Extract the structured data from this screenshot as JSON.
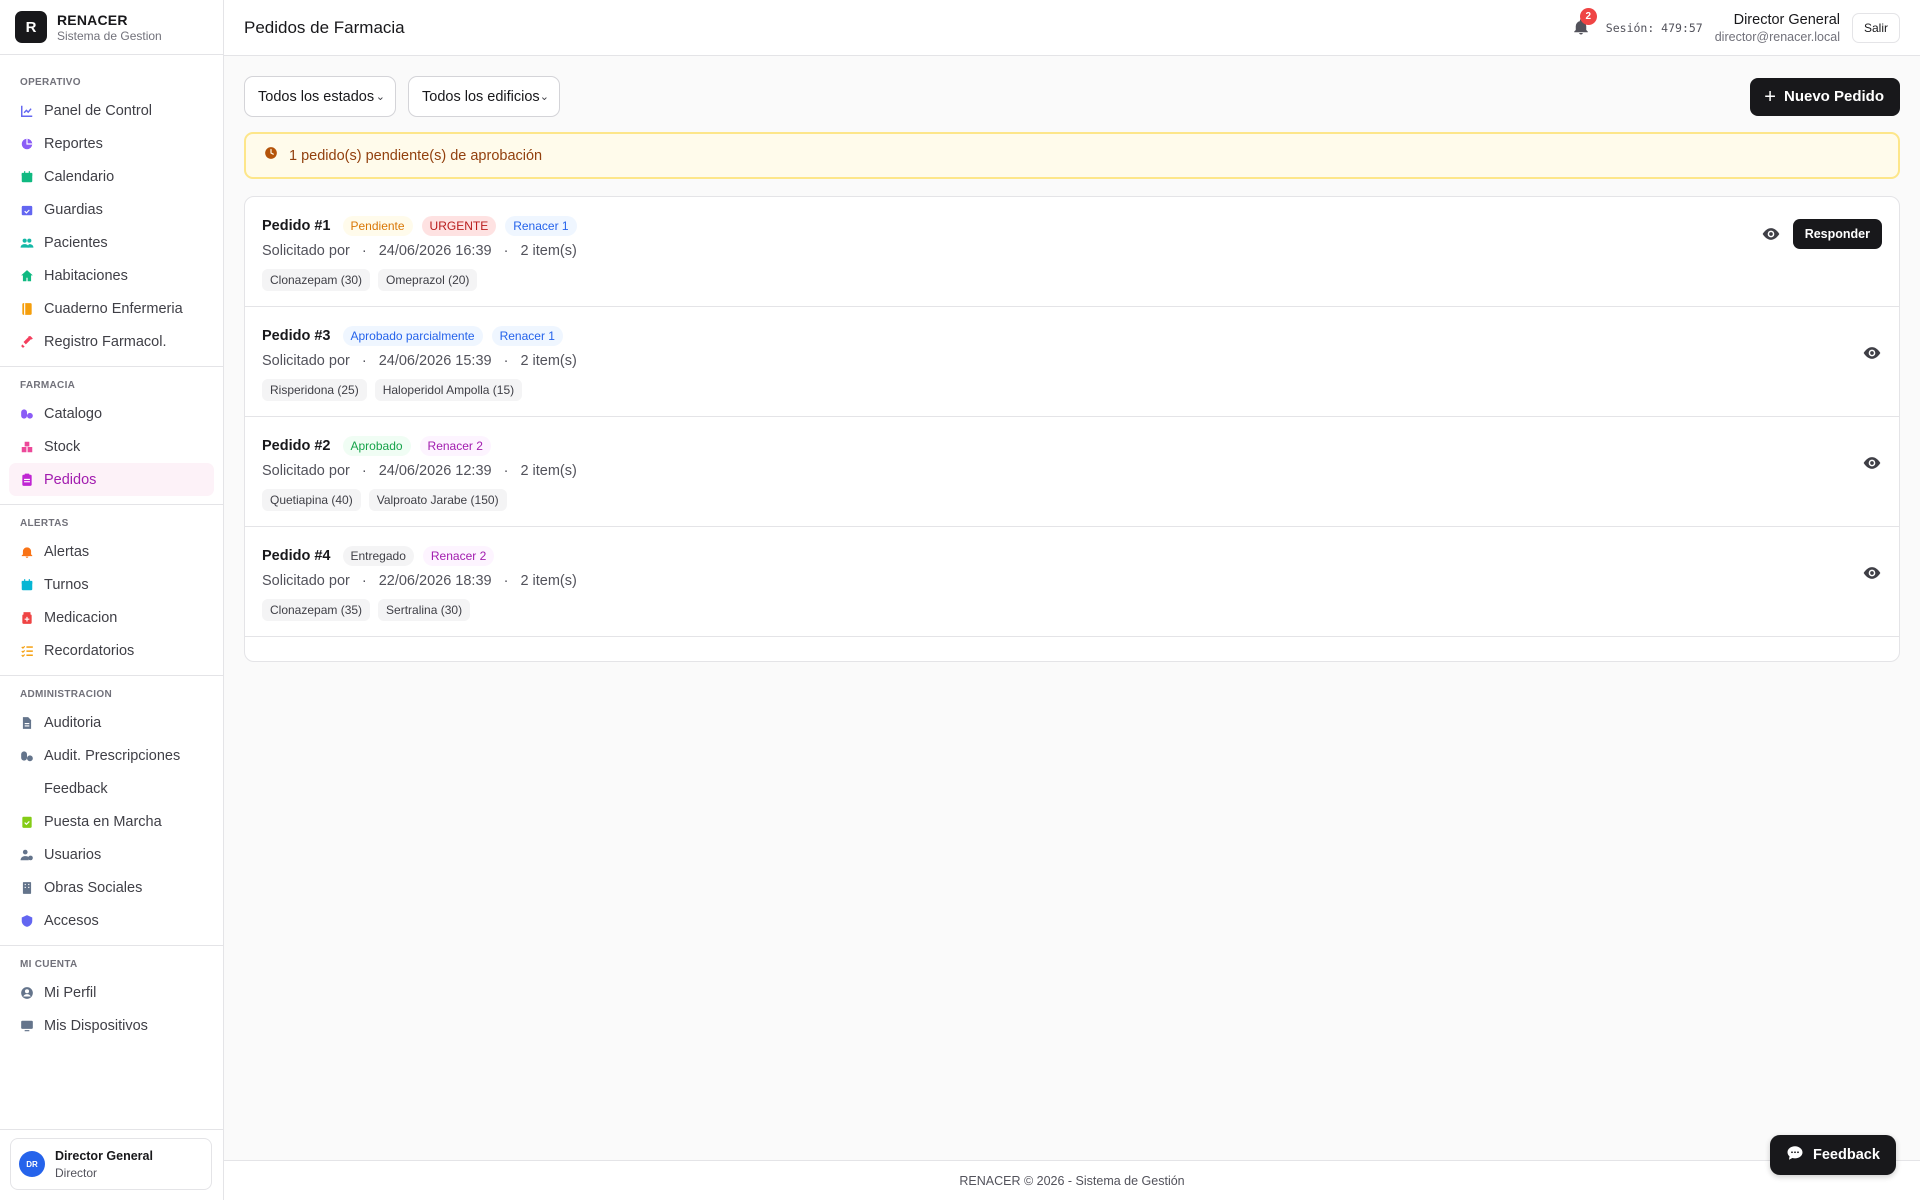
{
  "brand": {
    "logo_letter": "R",
    "title": "RENACER",
    "subtitle": "Sistema de Gestion"
  },
  "sidebar": {
    "sections": [
      {
        "title": "OPERATIVO",
        "items": [
          {
            "label": "Panel de Control",
            "icon": "chart-line-icon",
            "color": "#6366f1"
          },
          {
            "label": "Reportes",
            "icon": "pie-chart-icon",
            "color": "#8b5cf6"
          },
          {
            "label": "Calendario",
            "icon": "calendar-icon",
            "color": "#10b981"
          },
          {
            "label": "Guardias",
            "icon": "calendar-check-icon",
            "color": "#6366f1"
          },
          {
            "label": "Pacientes",
            "icon": "users-icon",
            "color": "#14b8a6"
          },
          {
            "label": "Habitaciones",
            "icon": "house-icon",
            "color": "#10b981"
          },
          {
            "label": "Cuaderno Enfermeria",
            "icon": "notebook-icon",
            "color": "#f59e0b"
          },
          {
            "label": "Registro Farmacol.",
            "icon": "syringe-icon",
            "color": "#f43f5e"
          }
        ]
      },
      {
        "title": "FARMACIA",
        "items": [
          {
            "label": "Catalogo",
            "icon": "pills-icon",
            "color": "#8b5cf6"
          },
          {
            "label": "Stock",
            "icon": "boxes-icon",
            "color": "#ec4899"
          },
          {
            "label": "Pedidos",
            "icon": "clipboard-icon",
            "color": "#c026d3",
            "active": true
          }
        ]
      },
      {
        "title": "ALERTAS",
        "items": [
          {
            "label": "Alertas",
            "icon": "bell-icon",
            "color": "#f97316"
          },
          {
            "label": "Turnos",
            "icon": "calendar-icon",
            "color": "#06b6d4"
          },
          {
            "label": "Medicacion",
            "icon": "medicine-icon",
            "color": "#ef4444"
          },
          {
            "label": "Recordatorios",
            "icon": "list-check-icon",
            "color": "#f59e0b"
          }
        ]
      },
      {
        "title": "ADMINISTRACION",
        "items": [
          {
            "label": "Auditoria",
            "icon": "file-icon",
            "color": "#64748b"
          },
          {
            "label": "Audit. Prescripciones",
            "icon": "prescription-icon",
            "color": "#64748b"
          },
          {
            "label": "Feedback",
            "icon": "comment-icon",
            "color": "#0ea5e9"
          },
          {
            "label": "Puesta en Marcha",
            "icon": "clipboard-check-icon",
            "color": "#84cc16"
          },
          {
            "label": "Usuarios",
            "icon": "user-gear-icon",
            "color": "#64748b"
          },
          {
            "label": "Obras Sociales",
            "icon": "building-icon",
            "color": "#64748b"
          },
          {
            "label": "Accesos",
            "icon": "shield-icon",
            "color": "#6366f1"
          }
        ]
      },
      {
        "title": "MI CUENTA",
        "items": [
          {
            "label": "Mi Perfil",
            "icon": "user-circle-icon",
            "color": "#64748b"
          },
          {
            "label": "Mis Dispositivos",
            "icon": "desktop-icon",
            "color": "#64748b"
          }
        ]
      }
    ],
    "user": {
      "initials": "DR",
      "name": "Director General",
      "role": "Director"
    }
  },
  "header": {
    "title": "Pedidos de Farmacia",
    "notifications_count": "2",
    "session": "Sesión: 479:57",
    "user_name": "Director General",
    "user_email": "director@renacer.local",
    "logout_label": "Salir"
  },
  "filters": {
    "status_selected": "Todos los estados",
    "building_selected": "Todos los edificios",
    "new_order_label": "Nuevo Pedido"
  },
  "alert": {
    "text": "1 pedido(s) pendiente(s) de aprobación"
  },
  "orders": [
    {
      "title": "Pedido #1",
      "badges": [
        {
          "text": "Pendiente",
          "kind": "b-pend"
        },
        {
          "text": "URGENTE",
          "kind": "b-urg"
        },
        {
          "text": "Renacer 1",
          "kind": "b-r1"
        }
      ],
      "requested_by": "Solicitado por",
      "date": "24/06/2026 16:39",
      "items": "2 item(s)",
      "chips": [
        "Clonazepam (30)",
        "Omeprazol (20)"
      ],
      "respond_label": "Responder"
    },
    {
      "title": "Pedido #3",
      "badges": [
        {
          "text": "Aprobado parcialmente",
          "kind": "b-apar"
        },
        {
          "text": "Renacer 1",
          "kind": "b-r1"
        }
      ],
      "requested_by": "Solicitado por",
      "date": "24/06/2026 15:39",
      "items": "2 item(s)",
      "chips": [
        "Risperidona (25)",
        "Haloperidol Ampolla (15)"
      ]
    },
    {
      "title": "Pedido #2",
      "badges": [
        {
          "text": "Aprobado",
          "kind": "b-apr"
        },
        {
          "text": "Renacer 2",
          "kind": "b-r2"
        }
      ],
      "requested_by": "Solicitado por",
      "date": "24/06/2026 12:39",
      "items": "2 item(s)",
      "chips": [
        "Quetiapina (40)",
        "Valproato Jarabe (150)"
      ]
    },
    {
      "title": "Pedido #4",
      "badges": [
        {
          "text": "Entregado",
          "kind": "b-ent"
        },
        {
          "text": "Renacer 2",
          "kind": "b-r2"
        }
      ],
      "requested_by": "Solicitado por",
      "date": "22/06/2026 18:39",
      "items": "2 item(s)",
      "chips": [
        "Clonazepam (35)",
        "Sertralina (30)"
      ]
    }
  ],
  "footer": {
    "text": "RENACER © 2026 - Sistema de Gestión"
  },
  "feedback_fab": {
    "label": "Feedback"
  }
}
